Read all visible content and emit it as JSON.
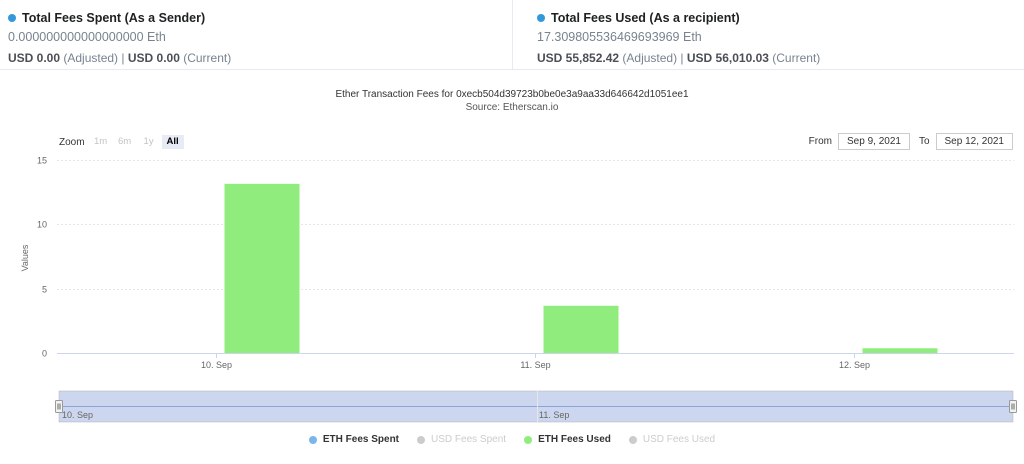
{
  "summary": {
    "sender": {
      "title": "Total Fees Spent (As a Sender)",
      "amount": "0.000000000000000000 Eth",
      "usd_adjusted": "USD 0.00",
      "adjusted_label": " (Adjusted) | ",
      "usd_current": "USD 0.00",
      "current_label": " (Current)",
      "dot_color": "#3498db"
    },
    "recipient": {
      "title": "Total Fees Used (As a recipient)",
      "amount": "17.309805536469693969 Eth",
      "usd_adjusted": "USD 55,852.42",
      "adjusted_label": " (Adjusted) | ",
      "usd_current": "USD 56,010.03",
      "current_label": " (Current)",
      "dot_color": "#3498db"
    }
  },
  "toolbar": {
    "zoom_label": "Zoom",
    "zoom_buttons": [
      "1m",
      "6m",
      "1y",
      "All"
    ],
    "active_zoom": "All",
    "from_label": "From",
    "from_value": "Sep 9, 2021",
    "to_label": "To",
    "to_value": "Sep 12, 2021"
  },
  "chart_data": {
    "type": "bar",
    "title": "Ether Transaction Fees for 0xecb504d39723b0be0e3a9aa33d646642d1051ee1",
    "subtitle": "Source: Etherscan.io",
    "ylabel": "Values",
    "xlabel": "",
    "categories": [
      "10. Sep",
      "11. Sep",
      "12. Sep"
    ],
    "yticks": [
      0,
      5,
      10,
      15
    ],
    "ylim": [
      0,
      15
    ],
    "grid": true,
    "series": [
      {
        "name": "ETH Fees Spent",
        "values": [
          0,
          0,
          0
        ],
        "color": "#7cb5ec",
        "visible": true
      },
      {
        "name": "USD Fees Spent",
        "values": [],
        "color": "#cccccc",
        "visible": false
      },
      {
        "name": "ETH Fees Used",
        "values": [
          13.15,
          3.67,
          0.37
        ],
        "color": "#90ed7d",
        "visible": true
      },
      {
        "name": "USD Fees Used",
        "values": [],
        "color": "#cccccc",
        "visible": false
      }
    ],
    "navigator_labels": [
      "10. Sep",
      "11. Sep"
    ],
    "legend_placement": "bottom"
  }
}
